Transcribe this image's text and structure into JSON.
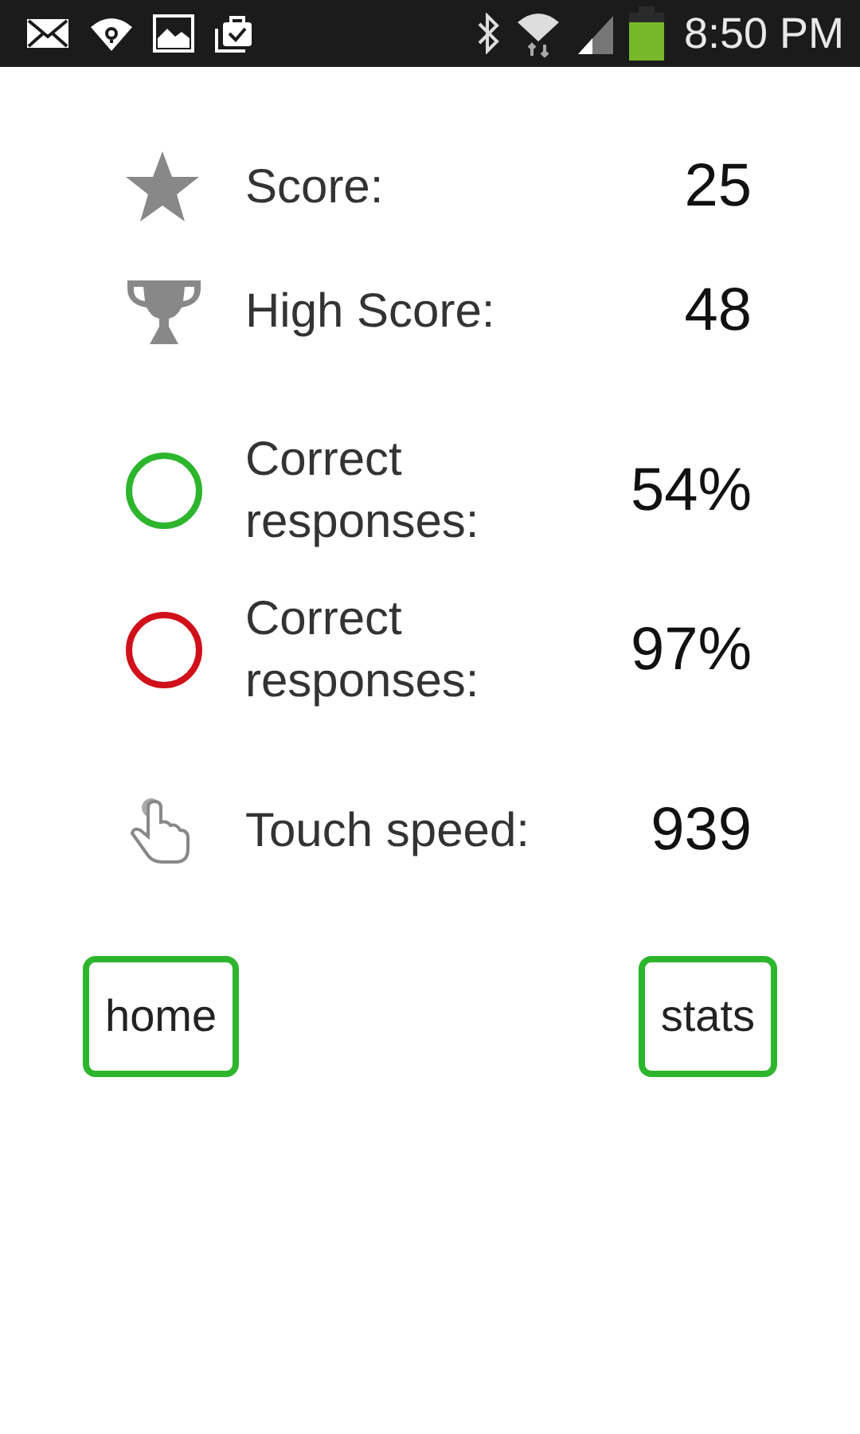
{
  "status_bar": {
    "time": "8:50 PM"
  },
  "stats": [
    {
      "kind": "star",
      "label": "Score:",
      "value": "25"
    },
    {
      "kind": "trophy",
      "label": "High Score:",
      "value": "48"
    },
    {
      "kind": "ring",
      "color": "#2db52d",
      "label": "Correct responses:",
      "value": "54%"
    },
    {
      "kind": "ring",
      "color": "#d0111b",
      "label": "Correct responses:",
      "value": "97%"
    },
    {
      "kind": "hand",
      "label": "Touch speed:",
      "value": "939"
    }
  ],
  "buttons": [
    "home",
    "stats"
  ]
}
